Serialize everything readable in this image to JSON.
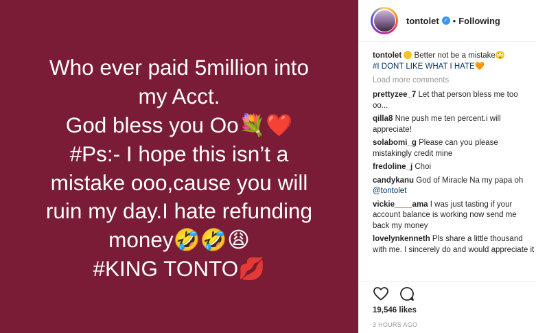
{
  "post": {
    "background": "#7a1c35",
    "lines": [
      "Who ever paid 5million into",
      "my Acct.",
      "God bless you Oo💐❤️",
      "#Ps:- I hope this isn’t a",
      "mistake ooo,cause you will",
      "ruin my day.I hate refunding",
      "money🤣🤣😩",
      "#KING TONTO💋"
    ]
  },
  "header": {
    "username": "tontolet",
    "verified_icon": "verified-badge-icon",
    "separator": "•",
    "follow_status": "Following"
  },
  "caption": {
    "user": "tontolet",
    "text": " Better not be a mistake🙄",
    "hashtag": "#I DONT LIKE WHAT I HATE🧡"
  },
  "load_more": "Load more comments",
  "comments": [
    {
      "user": "prettyzee_7",
      "text": "Let that person bless me too oo..."
    },
    {
      "user": "qilla8",
      "text": "Nne push me ten percent.i will appreciate!"
    },
    {
      "user": "solabomi_g",
      "text": "Please can you please mistakingly credit mine"
    },
    {
      "user": "fredoline_j",
      "text": "Choi"
    },
    {
      "user": "candykanu",
      "text": "God of Miracle Na my papa oh",
      "mention": "@tontolet"
    },
    {
      "user": "vickie____ama",
      "text": "I was just tasting if your account balance is working now send me back my money"
    },
    {
      "user": "lovelynkenneth",
      "text": "Pls share a little thousand with me. I sincerely do and would appreciate it"
    }
  ],
  "actions": {
    "like_icon": "heart-icon",
    "comment_icon": "comment-icon"
  },
  "likes": "19,546 likes",
  "timestamp": "3 HOURS AGO"
}
